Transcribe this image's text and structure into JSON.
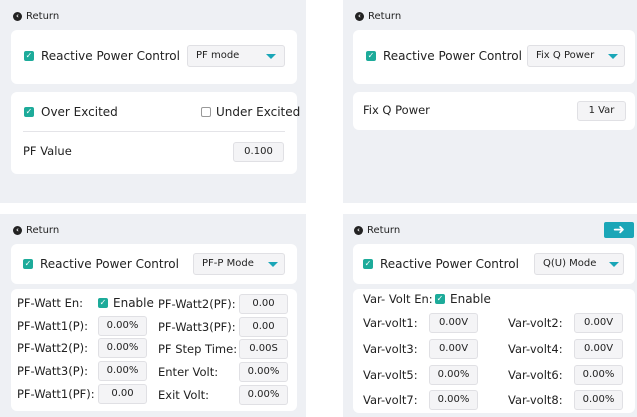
{
  "p1": {
    "return": "Return",
    "rpc_label": "Reactive Power Control",
    "mode": "PF mode",
    "over_excited": "Over Excited",
    "under_excited": "Under Excited",
    "pf_value_label": "PF Value",
    "pf_value": "0.100"
  },
  "p2": {
    "return": "Return",
    "rpc_label": "Reactive Power Control",
    "mode": "Fix Q Power",
    "fixq_label": "Fix Q Power",
    "fixq_value": "1 Var"
  },
  "p3": {
    "return": "Return",
    "rpc_label": "Reactive Power Control",
    "mode": "PF-P Mode",
    "watt_en_label": "PF-Watt En:",
    "enable": "Enable",
    "left": [
      {
        "label": "PF-Watt1(P):",
        "value": "0.00%"
      },
      {
        "label": "PF-Watt2(P):",
        "value": "0.00%"
      },
      {
        "label": "PF-Watt3(P):",
        "value": "0.00%"
      },
      {
        "label": "PF-Watt1(PF):",
        "value": "0.00"
      }
    ],
    "right": [
      {
        "label": "PF-Watt2(PF):",
        "value": "0.00"
      },
      {
        "label": "PF-Watt3(PF):",
        "value": "0.00"
      },
      {
        "label": "PF Step Time:",
        "value": "0.00S"
      },
      {
        "label": "Enter Volt:",
        "value": "0.00%"
      },
      {
        "label": "Exit Volt:",
        "value": "0.00%"
      }
    ]
  },
  "p4": {
    "return": "Return",
    "next_icon": "arrow-right-icon",
    "rpc_label": "Reactive Power Control",
    "mode": "Q(U) Mode",
    "volt_en_label": "Var- Volt En:",
    "enable": "Enable",
    "left": [
      {
        "label": "Var-volt1:",
        "value": "0.00V"
      },
      {
        "label": "Var-volt3:",
        "value": "0.00V"
      },
      {
        "label": "Var-volt5:",
        "value": "0.00%"
      },
      {
        "label": "Var-volt7:",
        "value": "0.00%"
      }
    ],
    "right": [
      {
        "label": "Var-volt2:",
        "value": "0.00V"
      },
      {
        "label": "Var-volt4:",
        "value": "0.00V"
      },
      {
        "label": "Var-volt6:",
        "value": "0.00%"
      },
      {
        "label": "Var-volt8:",
        "value": "0.00%"
      }
    ]
  },
  "colors": {
    "accent": "#1aa6b7",
    "checkbox": "#1dab9a",
    "panel_bg": "#eef0f4"
  }
}
